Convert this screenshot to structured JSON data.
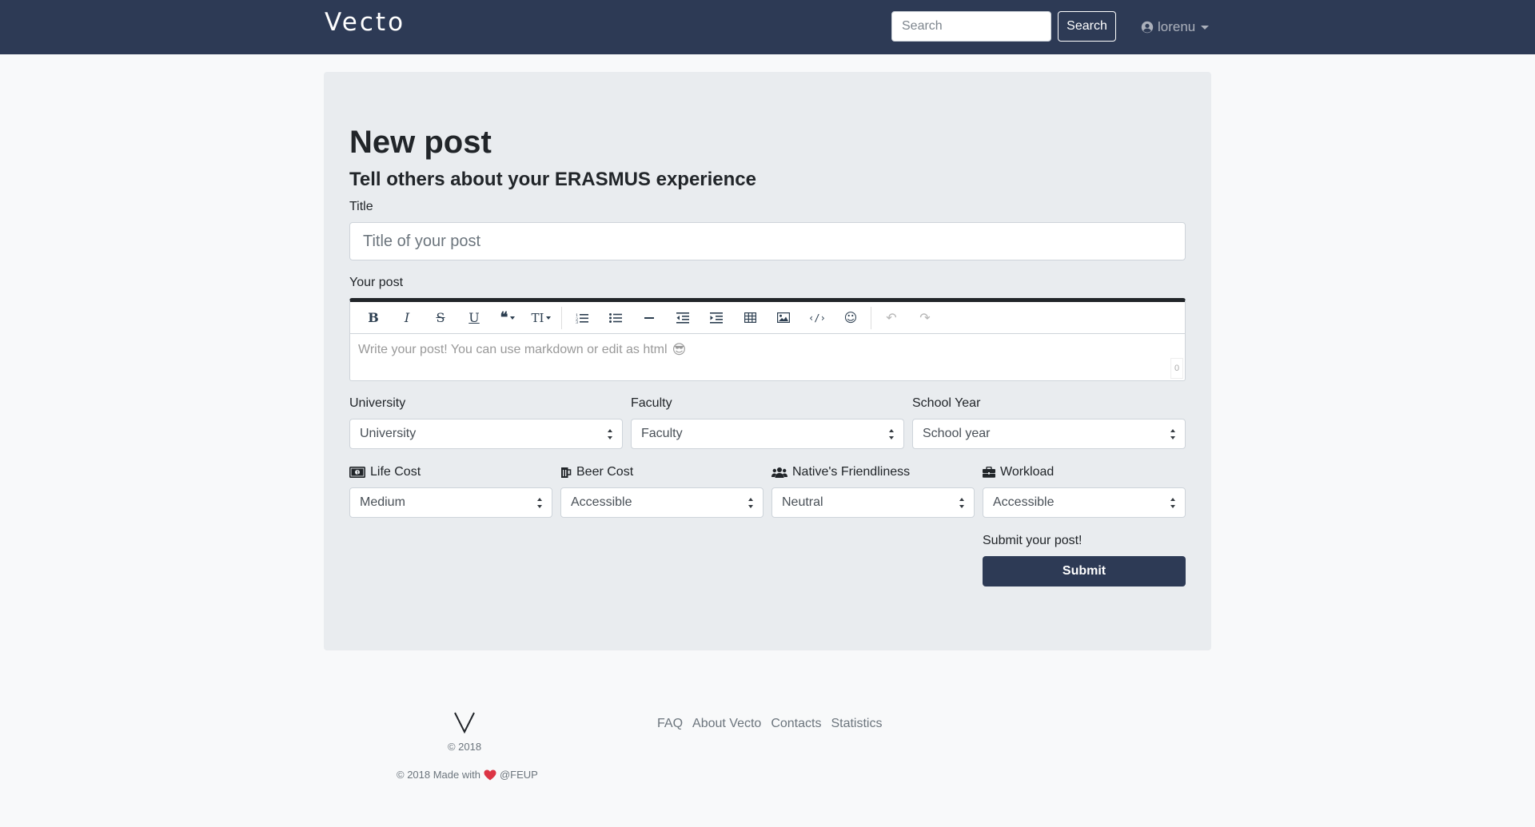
{
  "navbar": {
    "brand": "Vecto",
    "search_placeholder": "Search",
    "search_button": "Search",
    "user_name": "lorenu"
  },
  "form": {
    "page_title": "New post",
    "page_subtitle": "Tell others about your ERASMUS experience",
    "title_label": "Title",
    "title_placeholder": "Title of your post",
    "post_label": "Your post",
    "editor_placeholder": "Write your post! You can use markdown or edit as html",
    "editor_emoji": "😎",
    "char_count": "0",
    "toolbar": [
      {
        "name": "bold",
        "glyph": "B"
      },
      {
        "name": "italic",
        "glyph": "I"
      },
      {
        "name": "strikethrough",
        "glyph": "S"
      },
      {
        "name": "underline",
        "glyph": "U"
      },
      {
        "name": "quote",
        "glyph": "❝"
      },
      {
        "name": "text-size",
        "glyph": "TI"
      },
      {
        "name": "ordered-list",
        "glyph": "≔"
      },
      {
        "name": "unordered-list",
        "glyph": "☰"
      },
      {
        "name": "horizontal-rule",
        "glyph": "—"
      },
      {
        "name": "outdent",
        "glyph": "⇤"
      },
      {
        "name": "indent",
        "glyph": "⇥"
      },
      {
        "name": "table",
        "glyph": "▦"
      },
      {
        "name": "image",
        "glyph": "▣"
      },
      {
        "name": "code",
        "glyph": "‹/›"
      },
      {
        "name": "emoji",
        "glyph": "☺"
      },
      {
        "name": "undo",
        "glyph": "↶"
      },
      {
        "name": "redo",
        "glyph": "↷"
      }
    ],
    "university": {
      "label": "University",
      "value": "University"
    },
    "faculty": {
      "label": "Faculty",
      "value": "Faculty"
    },
    "school_year": {
      "label": "School Year",
      "value": "School year"
    },
    "life_cost": {
      "label": "Life Cost",
      "value": "Medium",
      "icon": "money-bill-icon"
    },
    "beer_cost": {
      "label": "Beer Cost",
      "value": "Accessible",
      "icon": "beer-icon"
    },
    "friendliness": {
      "label": "Native's Friendliness",
      "value": "Neutral",
      "icon": "users-icon"
    },
    "workload": {
      "label": "Workload",
      "value": "Accessible",
      "icon": "briefcase-icon"
    },
    "submit_label": "Submit your post!",
    "submit_button": "Submit"
  },
  "footer": {
    "logo_letter": "V",
    "copyright": "© 2018",
    "made_with_prefix": "© 2018 Made with",
    "made_with_suffix": "@FEUP",
    "links": [
      "FAQ",
      "About Vecto",
      "Contacts",
      "Statistics"
    ]
  },
  "colors": {
    "navbar": "#2d3a55",
    "card": "#e9ecef",
    "heart": "#dc3545"
  }
}
